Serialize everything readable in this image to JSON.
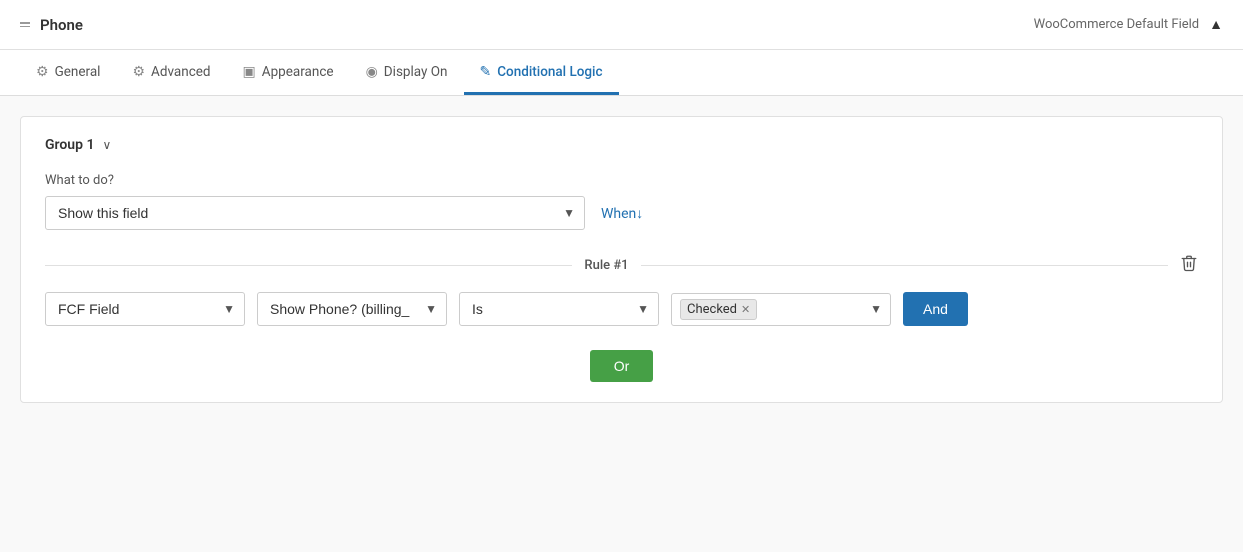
{
  "header": {
    "sort_icon": "sort-icon",
    "title": "Phone",
    "woo_label": "WooCommerce Default Field",
    "collapse_icon": "▲"
  },
  "tabs": [
    {
      "id": "general",
      "label": "General",
      "icon": "⚙",
      "active": false
    },
    {
      "id": "advanced",
      "label": "Advanced",
      "icon": "⚙",
      "active": false
    },
    {
      "id": "appearance",
      "label": "Appearance",
      "icon": "▣",
      "active": false
    },
    {
      "id": "display-on",
      "label": "Display On",
      "icon": "◉",
      "active": false
    },
    {
      "id": "conditional-logic",
      "label": "Conditional Logic",
      "icon": "✎",
      "active": true
    }
  ],
  "group": {
    "title": "Group 1",
    "chevron": "∨",
    "what_to_do": {
      "label": "What to do?",
      "action_value": "Show this field",
      "action_placeholder": "Show this field",
      "when_label": "When↓"
    },
    "rule": {
      "title": "Rule #1",
      "field_value": "FCF Field",
      "condition_value": "Show Phone? (billing_...",
      "operator_value": "Is",
      "tag_value": "Checked",
      "and_label": "And",
      "or_label": "Or"
    }
  }
}
